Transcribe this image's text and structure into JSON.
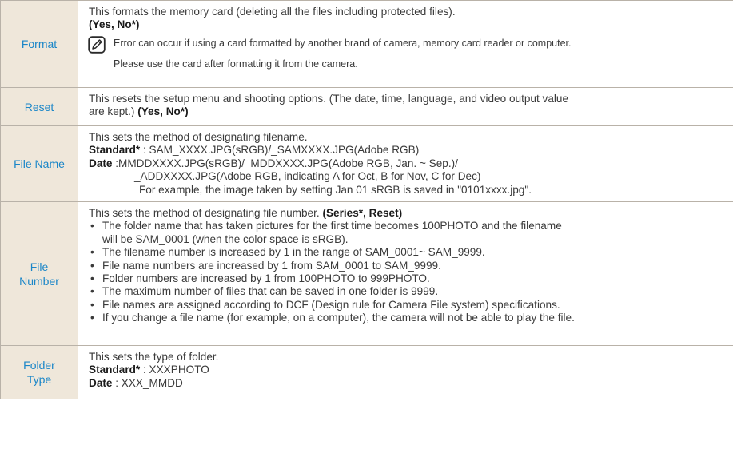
{
  "rows": {
    "format": {
      "label": "Format",
      "desc": "This formats the memory card (deleting all the files including protected files).",
      "options": "(Yes, No*)",
      "note": [
        "Error can occur if using a card formatted by another brand of camera, memory card reader or computer.",
        "Please use the card after formatting it from the camera."
      ],
      "note_icon": "note-pencil-icon"
    },
    "reset": {
      "label": "Reset",
      "desc_line1": "This resets the setup menu and shooting options. (The date, time, language, and video output value",
      "desc_line2": "are kept.)",
      "options": "(Yes, No*)"
    },
    "file_name": {
      "label": "File Name",
      "desc": "This sets the method of designating filename.",
      "standard_label": "Standard*",
      "standard_value": " : SAM_XXXX.JPG(sRGB)/_SAMXXXX.JPG(Adobe RGB)",
      "date_label": "Date",
      "date_lines": [
        " :MMDDXXXX.JPG(sRGB)/_MDDXXXX.JPG(Adobe RGB, Jan. ~ Sep.)/",
        "_ADDXXXX.JPG(Adobe RGB,  indicating A for Oct, B for Nov, C for Dec)",
        "For example, the image taken by setting Jan 01 sRGB is saved in \"0101xxxx.jpg\"."
      ]
    },
    "file_number": {
      "label_line1": "File",
      "label_line2": "Number",
      "desc": "This sets the method of designating file number.",
      "options": "(Series*, Reset)",
      "bullets": [
        [
          "The folder name that has taken pictures for the first time becomes 100PHOTO and the filename",
          "will be SAM_0001 (when the color space is sRGB)."
        ],
        [
          "The filename number is increased by 1 in the range of SAM_0001~ SAM_9999."
        ],
        [
          "File name numbers are increased by 1 from SAM_0001 to SAM_9999."
        ],
        [
          "Folder numbers are increased by 1 from 100PHOTO to 999PHOTO."
        ],
        [
          "The maximum number of files that can be saved in one folder is 9999."
        ],
        [
          "File names are assigned according to DCF (Design rule for Camera File system) specifications."
        ],
        [
          "If you change a file name (for example, on a computer), the camera will not be able to play the file."
        ]
      ]
    },
    "folder_type": {
      "label_line1": "Folder",
      "label_line2": "Type",
      "desc": "This sets the type of folder.",
      "standard_label": "Standard*",
      "standard_value": " : XXXPHOTO",
      "date_label": "Date",
      "date_value": " : XXX_MMDD"
    }
  },
  "colors": {
    "label_text": "#1a86c8",
    "label_bg": "#efe7da",
    "border": "#b9b2a8",
    "body_text": "#3a3a3a"
  }
}
